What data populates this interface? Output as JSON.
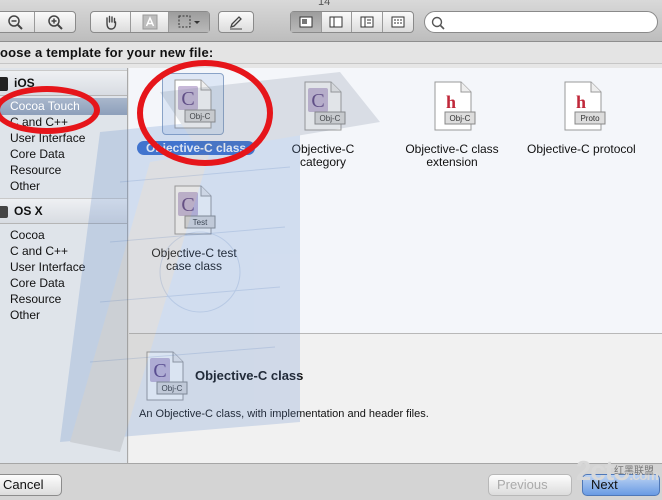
{
  "window": {
    "title_fragment": "14"
  },
  "header": {
    "title": "oose a template for your new file:"
  },
  "search": {
    "placeholder": ""
  },
  "sidebar": {
    "ios_label": "iOS",
    "ios_items": [
      "Cocoa Touch",
      "C and C++",
      "User Interface",
      "Core Data",
      "Resource",
      "Other"
    ],
    "osx_label": "OS X",
    "osx_items": [
      "Cocoa",
      "C and C++",
      "User Interface",
      "Core Data",
      "Resource",
      "Other"
    ],
    "selected": "Cocoa Touch"
  },
  "templates": [
    {
      "line1": "Objective-C class",
      "line2": "",
      "badge": "Obj-C",
      "glyph": "C",
      "selected": true
    },
    {
      "line1": "Objective-C",
      "line2": "category",
      "badge": "Obj-C",
      "glyph": "C",
      "selected": false
    },
    {
      "line1": "Objective-C class",
      "line2": "extension",
      "badge": "Obj-C",
      "glyph": "h",
      "selected": false
    },
    {
      "line1": "Objective-C protocol",
      "line2": "",
      "badge": "Proto",
      "glyph": "h",
      "selected": false
    },
    {
      "line1": "Objective-C test",
      "line2": "case class",
      "badge": "Test",
      "glyph": "C",
      "selected": false
    }
  ],
  "detail": {
    "title": "Objective-C class",
    "badge": "Obj-C",
    "glyph": "C",
    "description": "An Objective-C class, with implementation and header files."
  },
  "footer": {
    "cancel": "Cancel",
    "previous": "Previous",
    "next": "Next"
  },
  "watermark": {
    "logo": "2cto",
    "suffix": ".com",
    "cn": "红黑联盟"
  },
  "colors": {
    "selection": "#3a6fd0",
    "annotation": "#e6151a",
    "sidebar_bg": "#dfe4ea"
  }
}
